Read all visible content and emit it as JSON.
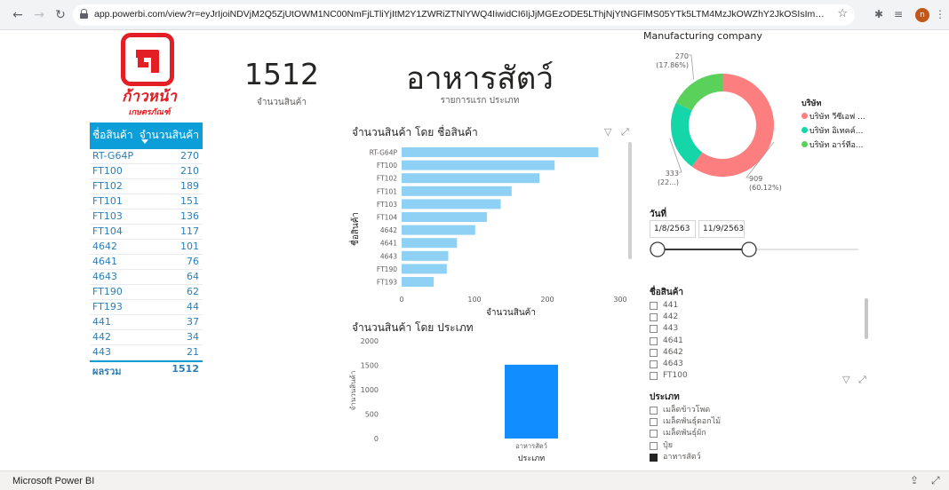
{
  "browser": {
    "url": "app.powerbi.com/view?r=eyJrIjoiNDVjM2Q5ZjUtOWM1NC00NmFjLTliYjItM2Y1ZWRiZTNlYWQ4IiwidCI6IjJjMGEzODE5LThjNjYtNGFlMS05YTk5LTM4MzJkOWZhY2JkOSIsImMiOjEwfQ%3D%3D&page...",
    "profile_initial": "n"
  },
  "logo": {
    "line1": "ก้าวหน้า",
    "line2": "เกษตรภัณฑ์"
  },
  "kpi": {
    "value": "1512",
    "label": "จำนวนสินค้า"
  },
  "title_card": {
    "value": "อาหารสัตว์",
    "label": "รายการแรก ประเภท"
  },
  "table": {
    "headers": [
      "ชื่อสินค้า",
      "จำนวนสินค้า"
    ],
    "rows": [
      [
        "RT-G64P",
        "270"
      ],
      [
        "FT100",
        "210"
      ],
      [
        "FT102",
        "189"
      ],
      [
        "FT101",
        "151"
      ],
      [
        "FT103",
        "136"
      ],
      [
        "FT104",
        "117"
      ],
      [
        "4642",
        "101"
      ],
      [
        "4641",
        "76"
      ],
      [
        "4643",
        "64"
      ],
      [
        "FT190",
        "62"
      ],
      [
        "FT193",
        "44"
      ],
      [
        "441",
        "37"
      ],
      [
        "442",
        "34"
      ],
      [
        "443",
        "21"
      ]
    ],
    "total_label": "ผลรวม",
    "total_value": "1512"
  },
  "bar_visual": {
    "title": "จำนวนสินค้า โดย ชื่อสินค้า"
  },
  "column_visual": {
    "title": "จำนวนสินค้า โดย ประเภท"
  },
  "donut_visual": {
    "title": "Manufacturing company",
    "legend_title": "บริษัท",
    "labels": [
      {
        "value": "909",
        "pct": "(60.12%)"
      },
      {
        "value": "333",
        "pct": "(22...)"
      },
      {
        "value": "270",
        "pct": "(17.86%)"
      }
    ]
  },
  "date_slicer": {
    "title": "วันที่",
    "start": "1/8/2563",
    "end": "11/9/2563"
  },
  "product_slicer": {
    "title": "ชื่อสินค้า",
    "items": [
      "441",
      "442",
      "443",
      "4641",
      "4642",
      "4643",
      "FT100"
    ]
  },
  "type_slicer": {
    "title": "ประเภท",
    "items": [
      "เมล็ดข้าวโพด",
      "เมล็ดพันธุ์ดอกไม้",
      "เมล็ดพันธุ์ผัก",
      "ปุ๋ย",
      "อาหารสัตว์"
    ],
    "checked": [
      false,
      false,
      false,
      false,
      true
    ]
  },
  "footer": {
    "label": "Microsoft Power BI"
  },
  "colors": {
    "accent": "#0b9ed9",
    "bar": "#8fd0f5",
    "column": "#118dff",
    "red": "#fd7e7e",
    "teal": "#14d6a8",
    "green": "#5ad15a"
  },
  "chart_data": [
    {
      "type": "bar",
      "orientation": "horizontal",
      "title": "จำนวนสินค้า โดย ชื่อสินค้า",
      "xlabel": "จำนวนสินค้า",
      "ylabel": "ชื่อสินค้า",
      "categories": [
        "RT-G64P",
        "FT100",
        "FT102",
        "FT101",
        "FT103",
        "FT104",
        "4642",
        "4641",
        "4643",
        "FT190",
        "FT193"
      ],
      "values": [
        270,
        210,
        189,
        151,
        136,
        117,
        101,
        76,
        64,
        62,
        44
      ],
      "xlim": [
        0,
        300
      ],
      "xticks": [
        "0",
        "100",
        "200",
        "300"
      ]
    },
    {
      "type": "bar",
      "title": "จำนวนสินค้า โดย ประเภท",
      "xlabel": "ประเภท",
      "ylabel": "จำนวนสินค้า",
      "categories": [
        "อาหารสัตว์"
      ],
      "values": [
        1512
      ],
      "ylim": [
        0,
        2000
      ],
      "yticks": [
        "0",
        "500",
        "1000",
        "1500",
        "2000"
      ]
    },
    {
      "type": "pie",
      "title": "Manufacturing company",
      "legend_title": "บริษัท",
      "legend_position": "right",
      "categories": [
        "บริษัท วีซีเอฟ ...",
        "บริษัท อิเทคค์...",
        "บริษัท อาร์ทีอ..."
      ],
      "values": [
        909,
        333,
        270
      ],
      "colors": [
        "#fd7e7e",
        "#14d6a8",
        "#5ad15a"
      ]
    }
  ]
}
